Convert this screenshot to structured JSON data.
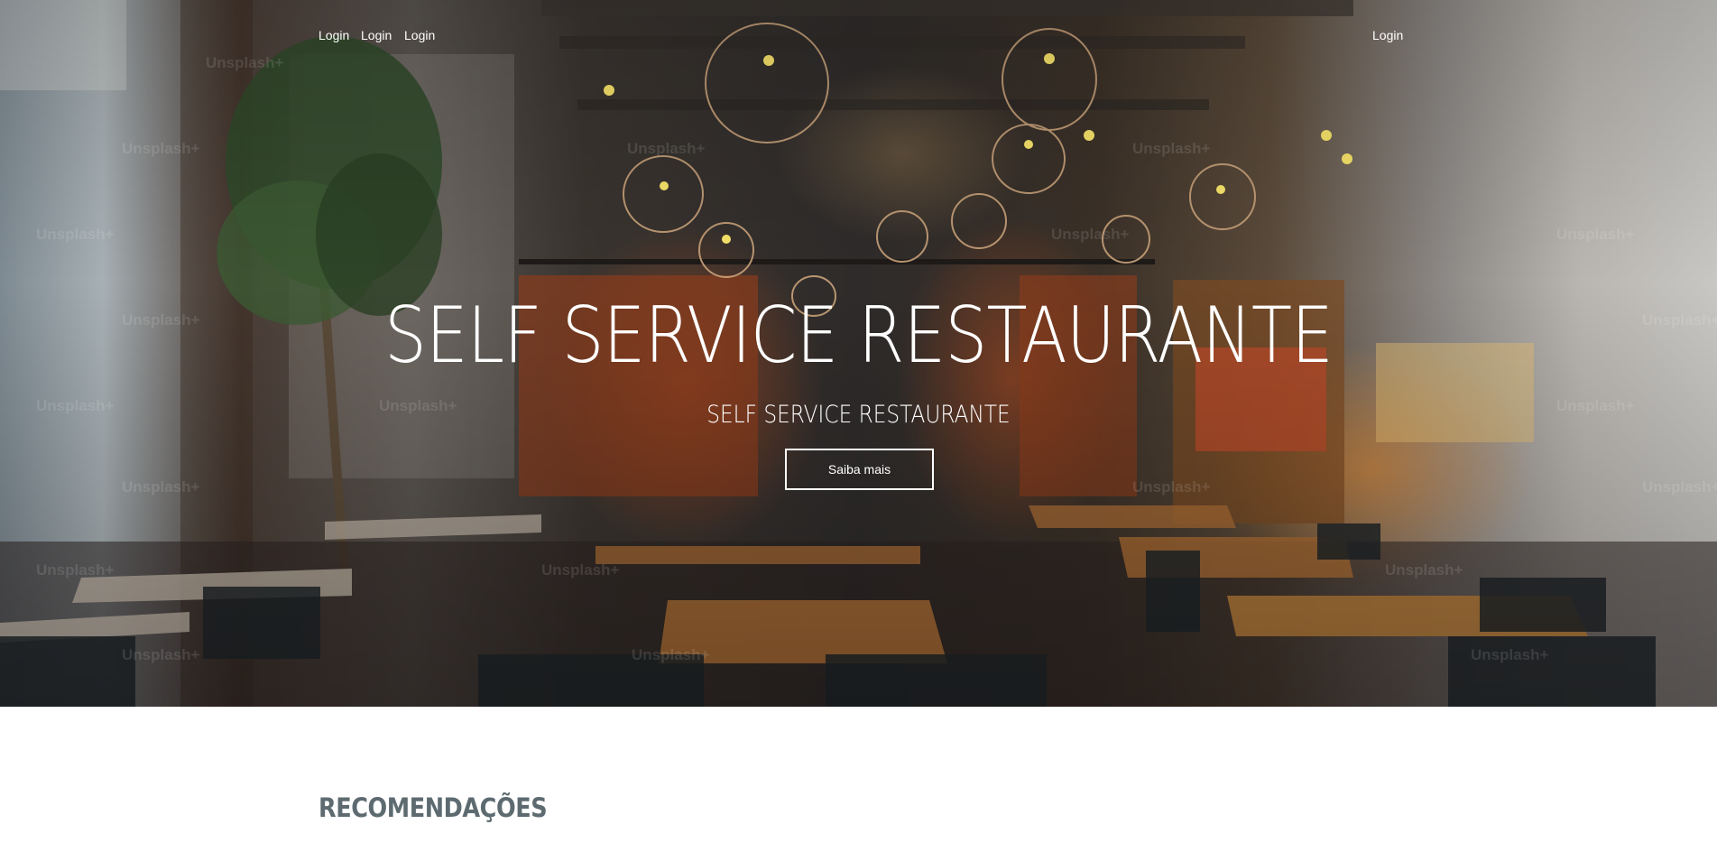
{
  "nav": {
    "left_links": [
      "Login",
      "Login",
      "Login"
    ],
    "right_link": "Login"
  },
  "hero": {
    "title": "SELF SERVICE RESTAURANTE",
    "subtitle": "SELF SERVICE RESTAURANTE",
    "button_label": "Saiba mais",
    "watermark_text": "Unsplash+"
  },
  "section": {
    "title": "RECOMENDAÇÕES"
  },
  "colors": {
    "text_on_hero": "#ffffff",
    "section_title": "#5d6b71",
    "page_background": "#ffffff"
  }
}
